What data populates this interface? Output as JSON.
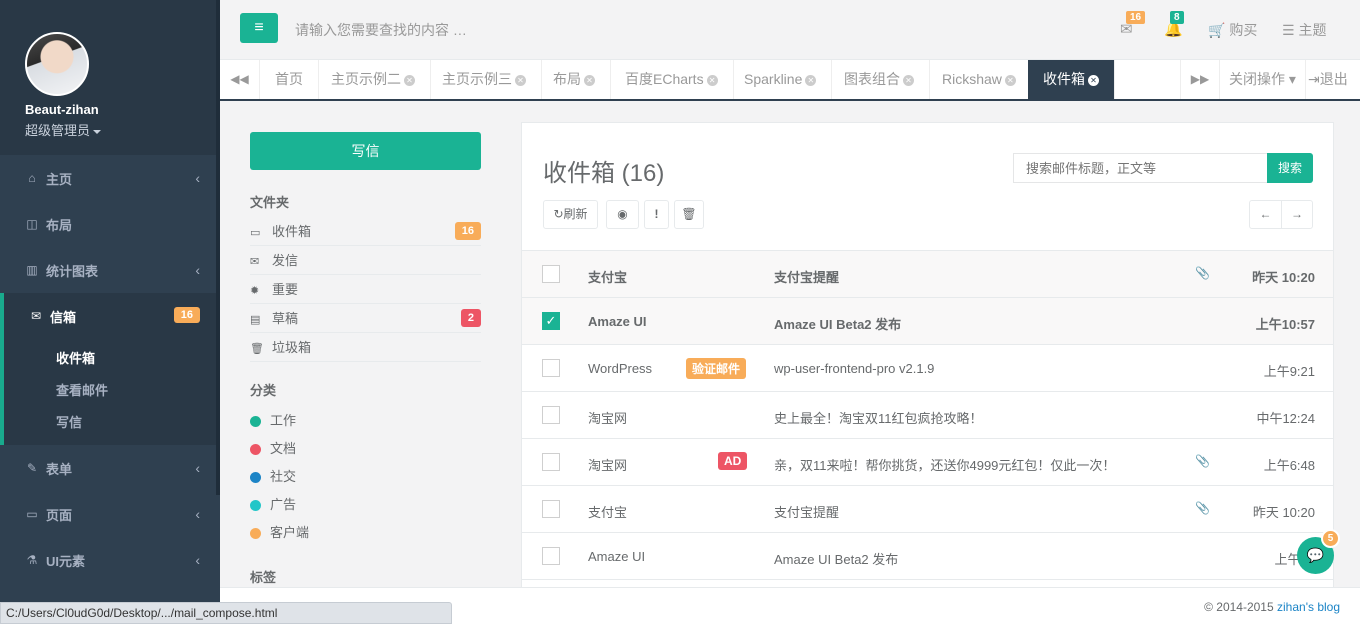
{
  "sidebar": {
    "profile": {
      "name": "Beaut-zihan",
      "role": "超级管理员"
    },
    "items": [
      {
        "label": "主页",
        "icon": "home-icon",
        "glyph": "⌂"
      },
      {
        "label": "布局",
        "icon": "columns-icon",
        "glyph": "◫"
      },
      {
        "label": "统计图表",
        "icon": "bar-chart-icon",
        "glyph": "▥"
      },
      {
        "label": "信箱",
        "icon": "envelope-icon",
        "glyph": "✉",
        "badge": "16"
      },
      {
        "label": "表单",
        "icon": "edit-icon",
        "glyph": "✎"
      },
      {
        "label": "页面",
        "icon": "desktop-icon",
        "glyph": "▭"
      },
      {
        "label": "UI元素",
        "icon": "flask-icon",
        "glyph": "⚗"
      }
    ],
    "sub_items": [
      "收件箱",
      "查看邮件",
      "写信"
    ]
  },
  "topbar": {
    "search_placeholder": "请输入您需要查找的内容 …",
    "mail_count": "16",
    "alert_count": "8",
    "buy_label": "购买",
    "theme_label": "主题",
    "colors": {
      "mail_badge": "#f8ac59",
      "alert_badge": "#1ab394"
    }
  },
  "tabs": {
    "items": [
      "首页",
      "主页示例二",
      "主页示例三",
      "布局",
      "百度ECharts",
      "Sparkline",
      "图表组合",
      "Rickshaw",
      "收件箱"
    ],
    "active": "收件箱",
    "close_ops": "关闭操作",
    "logout": "退出"
  },
  "mail_menu": {
    "compose": "写信",
    "folders_title": "文件夹",
    "folders": [
      {
        "label": "收件箱",
        "icon": "inbox-icon",
        "glyph": "▭",
        "badge": "16",
        "badge_color": "#f8ac59"
      },
      {
        "label": "发信",
        "icon": "envelope-o-icon",
        "glyph": "✉"
      },
      {
        "label": "重要",
        "icon": "certificate-icon",
        "glyph": "✹"
      },
      {
        "label": "草稿",
        "icon": "file-text-icon",
        "glyph": "▤",
        "badge": "2",
        "badge_color": "#ed5565"
      },
      {
        "label": "垃圾箱",
        "icon": "trash-icon",
        "glyph": "🗑"
      }
    ],
    "categories_title": "分类",
    "categories": [
      {
        "label": "工作",
        "color": "#1ab394"
      },
      {
        "label": "文档",
        "color": "#ed5565"
      },
      {
        "label": "社交",
        "color": "#1c84c6"
      },
      {
        "label": "广告",
        "color": "#23c6c8"
      },
      {
        "label": "客户端",
        "color": "#f8ac59"
      }
    ],
    "tags_title": "标签"
  },
  "mailbox": {
    "title": "收件箱 (16)",
    "search_placeholder": "搜索邮件标题，正文等",
    "search_button": "搜索",
    "refresh_label": "刷新",
    "rows": [
      {
        "from": "支付宝",
        "subject": "支付宝提醒",
        "time": "昨天 10:20",
        "attachment": true,
        "unread": true,
        "checked": false
      },
      {
        "from": "Amaze UI",
        "subject": "Amaze UI Beta2 发布",
        "time": "上午10:57",
        "attachment": false,
        "unread": true,
        "checked": true
      },
      {
        "from": "WordPress",
        "label": "验证邮件",
        "label_color": "#f8ac59",
        "subject": "wp-user-frontend-pro v2.1.9",
        "time": "上午9:21",
        "attachment": false,
        "unread": false,
        "checked": false
      },
      {
        "from": "淘宝网",
        "subject": "史上最全！淘宝双11红包疯抢攻略！",
        "time": "中午12:24",
        "attachment": false,
        "unread": false,
        "checked": false
      },
      {
        "from": "淘宝网",
        "label": "AD",
        "label_color": "#ed5565",
        "subject": "亲，双11来啦！帮你挑货，还送你4999元红包！仅此一次！",
        "time": "上午6:48",
        "attachment": true,
        "unread": false,
        "checked": false
      },
      {
        "from": "支付宝",
        "subject": "支付宝提醒",
        "time": "昨天 10:20",
        "attachment": true,
        "unread": false,
        "checked": false
      },
      {
        "from": "Amaze UI",
        "subject": "Amaze UI Beta2 发布",
        "time": "上午10",
        "attachment": false,
        "unread": false,
        "checked": false
      }
    ]
  },
  "footer": {
    "copyright": "© 2014-2015",
    "blog": "zihan's blog"
  },
  "status_url": "C:/Users/Cl0udG0d/Desktop/.../mail_compose.html",
  "chat_badge": "5"
}
